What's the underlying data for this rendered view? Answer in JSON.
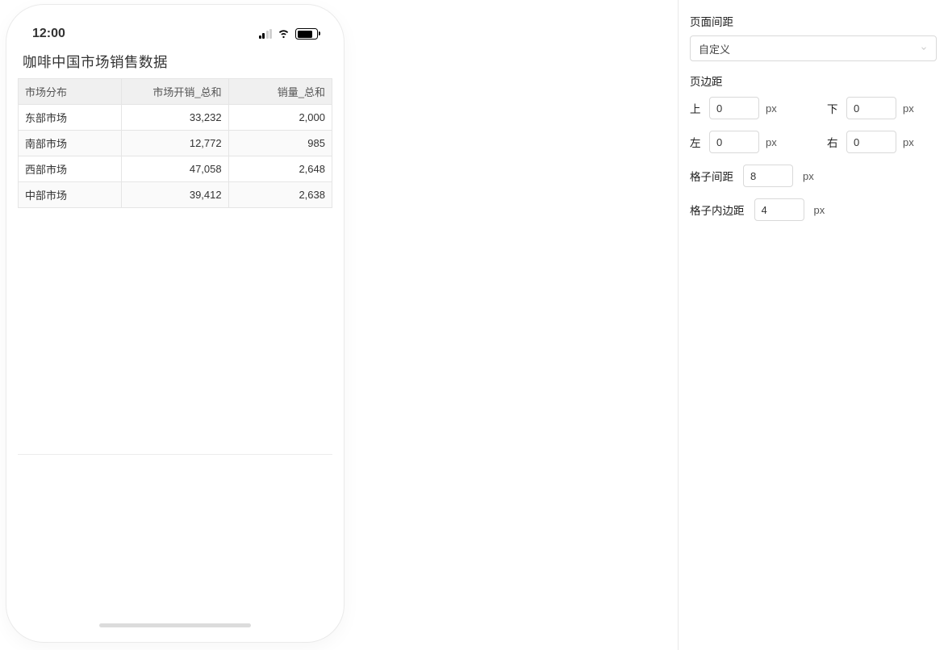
{
  "phone": {
    "status": {
      "time": "12:00"
    },
    "content": {
      "title": "咖啡中国市场销售数据",
      "table": {
        "headers": [
          "市场分布",
          "市场开销_总和",
          "销量_总和"
        ],
        "rows": [
          [
            "东部市场",
            "33,232",
            "2,000"
          ],
          [
            "南部市场",
            "12,772",
            "985"
          ],
          [
            "西部市场",
            "47,058",
            "2,648"
          ],
          [
            "中部市场",
            "39,412",
            "2,638"
          ]
        ]
      }
    }
  },
  "side": {
    "section1_label": "页面间距",
    "page_spacing_value": "自定义",
    "section2_label": "页边距",
    "margins": {
      "top": {
        "label": "上",
        "value": "0",
        "unit": "px"
      },
      "bottom": {
        "label": "下",
        "value": "0",
        "unit": "px"
      },
      "left": {
        "label": "左",
        "value": "0",
        "unit": "px"
      },
      "right": {
        "label": "右",
        "value": "0",
        "unit": "px"
      }
    },
    "grid_gap": {
      "label": "格子间距",
      "value": "8",
      "unit": "px"
    },
    "grid_padding": {
      "label": "格子内边距",
      "value": "4",
      "unit": "px"
    }
  }
}
